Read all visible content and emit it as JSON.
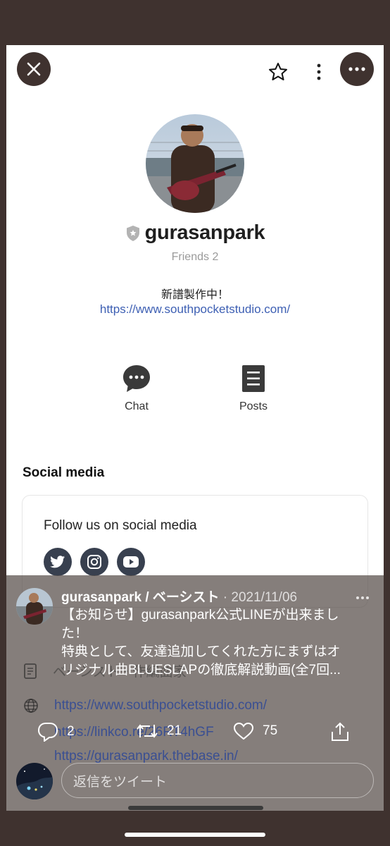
{
  "profile": {
    "name": "gurasanpark",
    "friends": "Friends 2",
    "status_message": "新譜製作中！",
    "link": "https://www.southpocketstudio.com/",
    "actions": {
      "chat": "Chat",
      "posts": "Posts"
    }
  },
  "social": {
    "section_title": "Social media",
    "box_title": "Follow us on social media",
    "icons": [
      "twitter-icon",
      "instagram-icon",
      "youtube-icon"
    ]
  },
  "background_rows": {
    "row1": "ベーシスト・作編曲家",
    "row2": "https://www.southpocketstudio.com/",
    "row3": "https://linkco.re/26RT4hGF",
    "row4": "https://gurasanpark.thebase.in/"
  },
  "tweet": {
    "author": "gurasanpark / ベーシスト",
    "date": "· 2021/11/06",
    "body_line1": "【お知らせ】gurasanpark公式LINEが出来まし",
    "body_line2": "た！",
    "body_line3": "特典として、友達追加してくれた方にまずはオ",
    "body_line4": "リジナル曲BLUESLAPの徹底解説動画(全7回...",
    "reply_count": "2",
    "retweet_count": "21",
    "like_count": "75",
    "reply_placeholder": "返信をツイート"
  },
  "colors": {
    "background": "#3f322f",
    "card": "#ffffff",
    "link": "#3d5fb3",
    "social_icon": "#38404f",
    "overlay": "rgba(86,76,72,0.72)"
  }
}
